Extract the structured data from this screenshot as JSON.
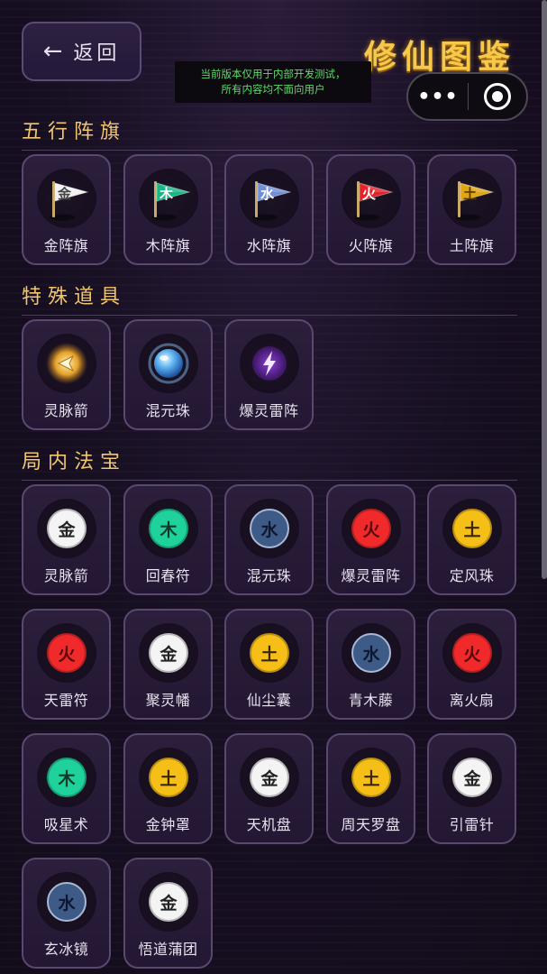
{
  "nav": {
    "back_arrow": "←",
    "back_label": "返回"
  },
  "title": "修仙图鉴",
  "notice": {
    "line1": "当前版本仅用于内部开发测试，",
    "line2": "所有内容均不面向用户"
  },
  "capsule": {
    "menu_icon": "•••",
    "close_icon": "target-icon"
  },
  "colors": {
    "金": "#f4f4f4",
    "木": "#1fd19a",
    "水": "#3e5a86",
    "火": "#f02a2a",
    "土": "#f5bf18",
    "title": "#f7c84a",
    "section": "#f1c66f"
  },
  "sections": [
    {
      "title": "五行阵旗",
      "items": [
        {
          "label": "金阵旗",
          "element": "金",
          "icon": "flag-icon",
          "flag_color": "#f1f1f1"
        },
        {
          "label": "木阵旗",
          "element": "木",
          "icon": "flag-icon",
          "flag_color": "#17b886"
        },
        {
          "label": "水阵旗",
          "element": "水",
          "icon": "flag-icon",
          "flag_color": "#6f8fd6"
        },
        {
          "label": "火阵旗",
          "element": "火",
          "icon": "flag-icon",
          "flag_color": "#e3222a"
        },
        {
          "label": "土阵旗",
          "element": "土",
          "icon": "flag-icon",
          "flag_color": "#e0a614"
        }
      ]
    },
    {
      "title": "特殊道具",
      "items": [
        {
          "label": "灵脉箭",
          "icon": "arrow-orb-icon"
        },
        {
          "label": "混元珠",
          "icon": "pearl-icon"
        },
        {
          "label": "爆灵雷阵",
          "icon": "lightning-icon"
        }
      ]
    },
    {
      "title": "局内法宝",
      "items": [
        {
          "label": "灵脉箭",
          "element": "金"
        },
        {
          "label": "回春符",
          "element": "木"
        },
        {
          "label": "混元珠",
          "element": "水"
        },
        {
          "label": "爆灵雷阵",
          "element": "火"
        },
        {
          "label": "定风珠",
          "element": "土"
        },
        {
          "label": "天雷符",
          "element": "火"
        },
        {
          "label": "聚灵幡",
          "element": "金"
        },
        {
          "label": "仙尘囊",
          "element": "土"
        },
        {
          "label": "青木藤",
          "element": "水"
        },
        {
          "label": "离火扇",
          "element": "火"
        },
        {
          "label": "吸星术",
          "element": "木"
        },
        {
          "label": "金钟罩",
          "element": "土"
        },
        {
          "label": "天机盘",
          "element": "金"
        },
        {
          "label": "周天罗盘",
          "element": "土"
        },
        {
          "label": "引雷针",
          "element": "金"
        },
        {
          "label": "玄冰镜",
          "element": "水"
        },
        {
          "label": "悟道蒲团",
          "element": "金"
        }
      ]
    }
  ]
}
